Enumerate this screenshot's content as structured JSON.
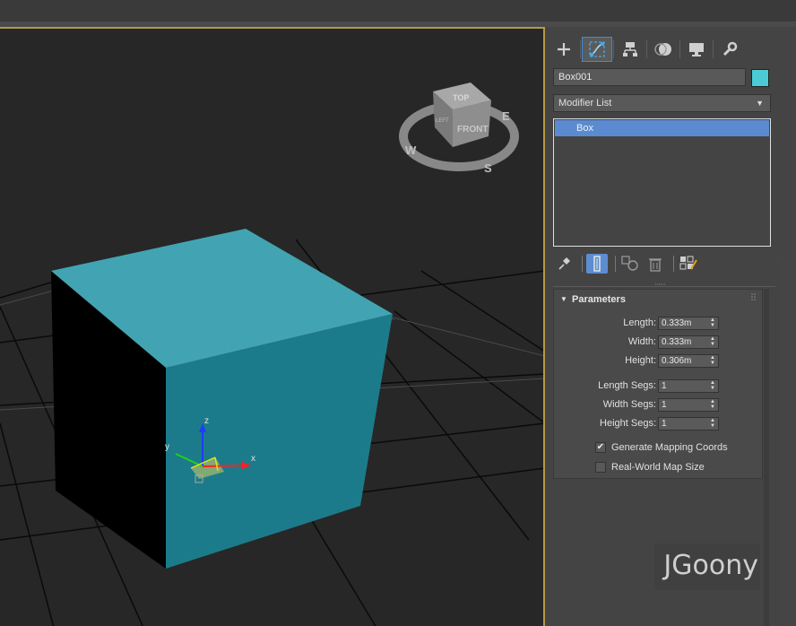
{
  "command_panel": {
    "tabs": [
      {
        "name": "create-tab",
        "icon": "plus-icon",
        "active": false
      },
      {
        "name": "modify-tab",
        "icon": "modify-curve-icon",
        "active": true
      },
      {
        "name": "hierarchy-tab",
        "icon": "hierarchy-icon",
        "active": false
      },
      {
        "name": "motion-tab",
        "icon": "motion-icon",
        "active": false
      },
      {
        "name": "display-tab",
        "icon": "monitor-icon",
        "active": false
      },
      {
        "name": "utilities-tab",
        "icon": "wrench-icon",
        "active": false
      }
    ],
    "object_name": "Box001",
    "object_color": "#4ccbd5",
    "modifier_list_label": "Modifier List",
    "stack_items": [
      "Box"
    ],
    "stack_tools": [
      "pin-icon",
      "show-end-result-icon",
      "make-unique-icon",
      "trash-icon",
      "configure-sets-icon"
    ]
  },
  "parameters": {
    "title": "Parameters",
    "length_label": "Length:",
    "length_value": "0.333m",
    "width_label": "Width:",
    "width_value": "0.333m",
    "height_label": "Height:",
    "height_value": "0.306m",
    "length_segs_label": "Length Segs:",
    "length_segs_value": "1",
    "width_segs_label": "Width Segs:",
    "width_segs_value": "1",
    "height_segs_label": "Height Segs:",
    "height_segs_value": "1",
    "gen_mapping_label": "Generate Mapping Coords",
    "gen_mapping_checked": true,
    "real_world_label": "Real-World Map Size",
    "real_world_checked": false
  },
  "viewcube": {
    "top": "TOP",
    "front": "FRONT",
    "left": "LEFT",
    "compass": {
      "w": "W",
      "s": "S",
      "e": "E"
    }
  },
  "gizmo": {
    "x": "x",
    "y": "y",
    "z": "z"
  },
  "colors": {
    "box_top": "#42a4b2",
    "box_front": "#1c7b8a",
    "box_side": "#000000",
    "viewport_border": "#b59a45"
  },
  "watermark": "JGoony"
}
